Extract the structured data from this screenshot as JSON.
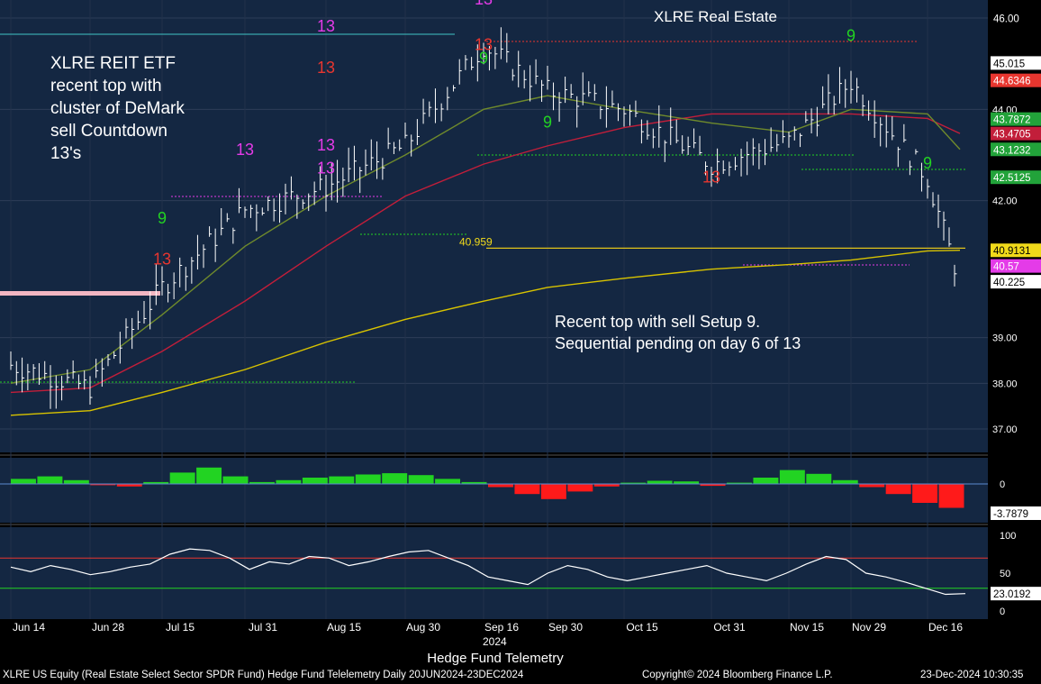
{
  "chart_data": {
    "type": "line",
    "title": "XLRE Real Estate",
    "ticker": "XLRE US Equity",
    "main_panel": {
      "ylim": [
        36.4,
        46.4
      ],
      "y_ticks": [
        "46.00",
        "44.00",
        "42.00",
        "39.00",
        "38.00",
        "37.00"
      ],
      "y_tick_values": [
        46.0,
        44.0,
        42.0,
        39.0,
        38.0,
        37.0
      ],
      "price_series": [
        {
          "date": "Jun 14",
          "close": 38.4
        },
        {
          "date": "Jun 28",
          "close": 37.9
        },
        {
          "date": "Jul 15",
          "close": 40.1
        },
        {
          "date": "Jul 31",
          "close": 41.8
        },
        {
          "date": "Aug 15",
          "close": 42.3
        },
        {
          "date": "Aug 30",
          "close": 43.2
        },
        {
          "date": "Sep 16",
          "close": 45.4
        },
        {
          "date": "Sep 30",
          "close": 44.4
        },
        {
          "date": "Oct 15",
          "close": 44.0
        },
        {
          "date": "Oct 31",
          "close": 42.8
        },
        {
          "date": "Nov 15",
          "close": 43.3
        },
        {
          "date": "Nov 29",
          "close": 44.6
        },
        {
          "date": "Dec 16",
          "close": 42.5
        },
        {
          "date": "Dec 23",
          "close": 40.2
        }
      ],
      "moving_averages": [
        {
          "name": "",
          "color": "#d8c300",
          "last": 40.9131,
          "values": [
            37.3,
            37.4,
            37.8,
            38.3,
            38.9,
            39.4,
            39.8,
            40.1,
            40.3,
            40.5,
            40.6,
            40.7,
            40.9,
            40.9131
          ]
        },
        {
          "name": "",
          "color": "#c21e3a",
          "last": 43.4705,
          "values": [
            37.8,
            37.9,
            38.7,
            39.8,
            41.0,
            42.1,
            42.8,
            43.2,
            43.6,
            43.9,
            43.9,
            43.9,
            43.8,
            43.4705
          ]
        },
        {
          "name": "",
          "color": "#6f8a2c",
          "last": 43.1232,
          "values": [
            38.0,
            38.3,
            39.5,
            41.0,
            42.1,
            43.0,
            44.0,
            44.3,
            44.0,
            43.7,
            43.5,
            44.0,
            43.9,
            43.1232
          ]
        }
      ],
      "right_labels": [
        {
          "text": "46.00",
          "bg": "#000000",
          "fg": "#ffffff",
          "value": 46.0
        },
        {
          "text": "45.015",
          "bg": "#ffffff",
          "fg": "#000000",
          "value": 45.015
        },
        {
          "text": "44.6346",
          "bg": "#e8362f",
          "fg": "#ffffff",
          "value": 44.6346
        },
        {
          "text": "43.7872",
          "bg": "#22a33a",
          "fg": "#ffffff",
          "value": 43.7872
        },
        {
          "text": "43.4705",
          "bg": "#c21e3a",
          "fg": "#ffffff",
          "value": 43.4705
        },
        {
          "text": "43.1232",
          "bg": "#22a33a",
          "fg": "#ffffff",
          "value": 43.1232
        },
        {
          "text": "42.5125",
          "bg": "#22a33a",
          "fg": "#ffffff",
          "value": 42.5125
        },
        {
          "text": "40.9131",
          "bg": "#f1da1a",
          "fg": "#000000",
          "value": 40.9131
        },
        {
          "text": "40.57",
          "bg": "#e43be8",
          "fg": "#ffffff",
          "value": 40.57
        },
        {
          "text": "40.225",
          "bg": "#ffffff",
          "fg": "#000000",
          "value": 40.225
        }
      ],
      "level_label": "40.959",
      "level_value": 40.959
    },
    "momentum_panel": {
      "zero_label": "0",
      "last_label": "-3.7879",
      "last_value": -3.7879,
      "values": [
        0.8,
        1.2,
        0.6,
        -0.2,
        -0.4,
        0.3,
        1.8,
        2.6,
        1.2,
        0.3,
        0.6,
        1.0,
        1.2,
        1.5,
        1.7,
        1.4,
        0.8,
        0.3,
        -0.5,
        -1.6,
        -2.4,
        -1.2,
        -0.4,
        0.2,
        0.5,
        0.4,
        -0.3,
        0.2,
        1.0,
        2.2,
        1.6,
        0.6,
        -0.5,
        -1.6,
        -3.0,
        -3.7879
      ]
    },
    "rsi_panel": {
      "y_ticks": [
        "100",
        "50",
        "0"
      ],
      "y_tick_values": [
        100,
        50,
        0
      ],
      "upper": 70,
      "lower": 30,
      "last_label": "23.0192",
      "last_value": 23.0192,
      "values": [
        58,
        52,
        60,
        55,
        48,
        52,
        58,
        62,
        75,
        82,
        80,
        70,
        55,
        65,
        62,
        72,
        70,
        60,
        65,
        72,
        78,
        80,
        70,
        60,
        45,
        40,
        35,
        50,
        60,
        55,
        45,
        40,
        45,
        50,
        55,
        60,
        50,
        45,
        40,
        50,
        62,
        72,
        68,
        50,
        45,
        38,
        30,
        22,
        23.0192
      ]
    },
    "x_ticks": [
      "Jun 14",
      "Jun 28",
      "Jul 15",
      "Jul 31",
      "Aug 15",
      "Aug 30",
      "Sep 16",
      "Sep 30",
      "Oct 15",
      "Oct 31",
      "Nov 15",
      "Nov 29",
      "Dec 16"
    ],
    "year_label": "2024",
    "demark_labels": [
      {
        "text": "13",
        "color": "#e8362f",
        "date": "Jul 15",
        "price": 40.6
      },
      {
        "text": "9",
        "color": "#22d322",
        "date": "Jul 15",
        "price": 41.5
      },
      {
        "text": "13",
        "color": "#e43be8",
        "date": "Jul 31",
        "price": 43.0
      },
      {
        "text": "13",
        "color": "#e43be8",
        "date": "Aug 15",
        "price": 43.1
      },
      {
        "text": "13",
        "color": "#e43be8",
        "date": "Aug 15",
        "price": 42.6
      },
      {
        "text": "13",
        "color": "#e43be8",
        "date": "Aug 15",
        "price": 45.7
      },
      {
        "text": "13",
        "color": "#e8362f",
        "date": "Aug 15",
        "price": 44.8
      },
      {
        "text": "9",
        "color": "#22d322",
        "date": "Sep 16",
        "price": 45.0
      },
      {
        "text": "13",
        "color": "#e8362f",
        "date": "Sep 16",
        "price": 45.3
      },
      {
        "text": "13",
        "color": "#e43be8",
        "date": "Sep 16",
        "price": 46.3
      },
      {
        "text": "9",
        "color": "#22d322",
        "date": "Sep 30",
        "price": 43.6
      },
      {
        "text": "13",
        "color": "#e8362f",
        "date": "Oct 31",
        "price": 42.4
      },
      {
        "text": "9",
        "color": "#22d322",
        "date": "Nov 29",
        "price": 45.5
      },
      {
        "text": "9",
        "color": "#22d322",
        "date": "Dec 16",
        "price": 42.7
      }
    ]
  },
  "annotations": {
    "left": "XLRE REIT ETF\nrecent top with\ncluster of DeMark\nsell Countdown\n13's",
    "mid": "Recent top with sell Setup 9.\nSequential pending on day 6 of 13"
  },
  "footer": {
    "center": "Hedge Fund Telemetry",
    "left": "XLRE US Equity (Real Estate Select Sector SPDR Fund) Hedge Fund Telelemetry  Daily 20JUN2024-23DEC2024",
    "copyright": "Copyright© 2024 Bloomberg Finance L.P.",
    "datetime": "23-Dec-2024  10:30:35"
  },
  "colors": {
    "panel_bg": "#142742",
    "price_bar": "#ffffff",
    "setup_green": "#22d322",
    "countdown_red": "#e8362f",
    "countdown_magenta": "#e43be8",
    "momentum_pos": "#22d322",
    "momentum_neg": "#ff1a1a",
    "rsi_line": "#ffffff",
    "rsi_upper": "#e8362f",
    "rsi_lower": "#22d322"
  }
}
